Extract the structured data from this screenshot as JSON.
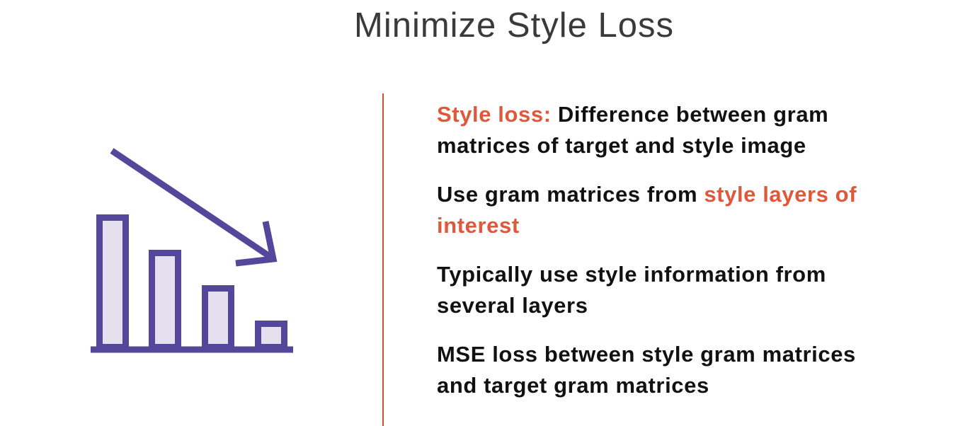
{
  "title": "Minimize Style Loss",
  "colors": {
    "accent": "#e0573a",
    "divider": "#c9532f",
    "icon_stroke": "#54479b",
    "icon_fill": "#e4e0f0",
    "text": "#111111"
  },
  "icon": "declining-bar-chart-with-down-arrow-icon",
  "bullets": [
    {
      "lines": [
        [
          {
            "text": "Style loss: ",
            "highlight": true
          },
          {
            "text": "Difference between gram",
            "highlight": false
          }
        ],
        [
          {
            "text": "matrices of target and style image",
            "highlight": false
          }
        ]
      ]
    },
    {
      "lines": [
        [
          {
            "text": "Use gram matrices from ",
            "highlight": false
          },
          {
            "text": "style layers of",
            "highlight": true
          }
        ],
        [
          {
            "text": "interest",
            "highlight": true
          }
        ]
      ]
    },
    {
      "lines": [
        [
          {
            "text": "Typically use style information from",
            "highlight": false
          }
        ],
        [
          {
            "text": "several layers",
            "highlight": false
          }
        ]
      ]
    },
    {
      "lines": [
        [
          {
            "text": "MSE loss between style gram matrices",
            "highlight": false
          }
        ],
        [
          {
            "text": "and target gram matrices",
            "highlight": false
          }
        ]
      ]
    }
  ]
}
